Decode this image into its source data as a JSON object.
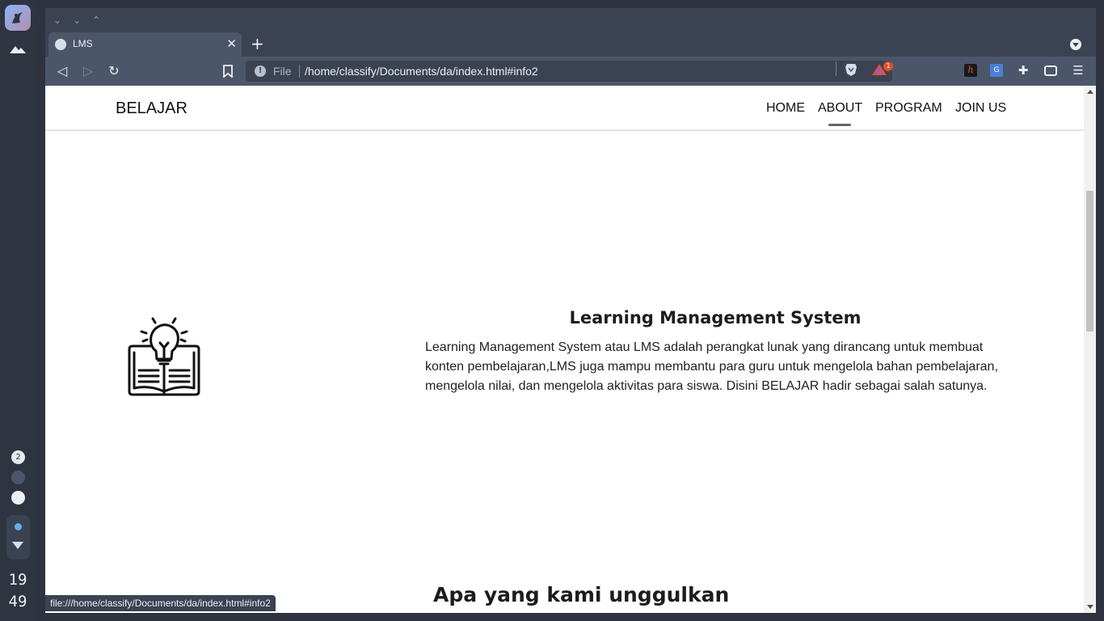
{
  "dock": {
    "workspace_number": "2",
    "clock_hour": "19",
    "clock_minute": "49"
  },
  "browser": {
    "tab_title": "LMS",
    "new_tab_symbol": "+",
    "url_scheme": "File",
    "url_path": "/home/classify/Documents/da/index.html#info2",
    "rewards_badge": "1",
    "status_url": "file:///home/classify/Documents/da/index.html#info2"
  },
  "site": {
    "brand": "BELAJAR",
    "nav": [
      "HOME",
      "ABOUT",
      "PROGRAM",
      "JOIN US"
    ],
    "active_nav": "ABOUT",
    "lms_title": "Learning Management System",
    "lms_text": "Learning Management System atau LMS adalah perangkat lunak yang dirancang untuk membuat konten pembelajaran,LMS juga mampu membantu para guru untuk mengelola bahan pembelajaran, mengelola nilai, dan mengelola aktivitas para siswa. Disini BELAJAR hadir sebagai salah satunya.",
    "section2_title": "Apa yang kami unggulkan"
  },
  "colors": {
    "dock": "#2e3440",
    "toolbar": "#4c566a",
    "accent_pink": "#e86fa6",
    "accent_blue": "#5eb1e8",
    "accent_purple": "#c08de8",
    "badge": "#e2502d"
  },
  "icons": {
    "dock_logo": "app-logo-icon",
    "lms_illustration": "lightbulb-book-icon"
  }
}
